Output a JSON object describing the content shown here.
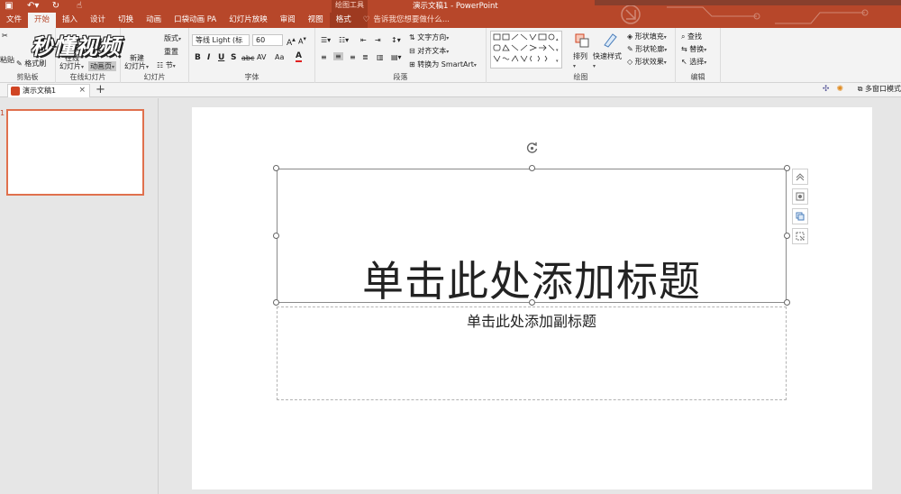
{
  "titlebar": {
    "window_title": "演示文稿1 - PowerPoint",
    "context_tools_label": "绘图工具",
    "tell_me_placeholder": "告诉我您想要做什么..."
  },
  "tabs": [
    {
      "label": "文件"
    },
    {
      "label": "开始"
    },
    {
      "label": "插入"
    },
    {
      "label": "设计"
    },
    {
      "label": "切换"
    },
    {
      "label": "动画"
    },
    {
      "label": "口袋动画 PA"
    },
    {
      "label": "幻灯片放映"
    },
    {
      "label": "审阅"
    },
    {
      "label": "视图"
    },
    {
      "label": "格式"
    }
  ],
  "ribbon": {
    "clipboard": {
      "paste": "粘贴",
      "format_painter": "格式刷",
      "label": "剪贴板"
    },
    "online_slides": {
      "online": "在线",
      "slide": "幻灯片",
      "anim": "动画页",
      "label": "在线幻灯片"
    },
    "slides": {
      "new": "新建",
      "slide": "幻灯片",
      "layout": "版式",
      "reset": "重置",
      "section": "节",
      "label": "幻灯片"
    },
    "font": {
      "name": "等线 Light (标",
      "size": "60",
      "label": "字体",
      "bold": "B",
      "italic": "I",
      "underline": "U",
      "shadow": "S",
      "strike": "abc",
      "spacing": "AV",
      "case": "Aa",
      "color": "A"
    },
    "paragraph": {
      "text_direction": "文字方向",
      "align_text": "对齐文本",
      "smartart": "转换为 SmartArt",
      "label": "段落"
    },
    "drawing": {
      "arrange": "排列",
      "quick_styles": "快速样式",
      "shape_fill": "形状填充",
      "shape_outline": "形状轮廓",
      "shape_effects": "形状效果",
      "label": "绘图"
    },
    "editing": {
      "find": "查找",
      "replace": "替换",
      "select": "选择",
      "label": "编辑"
    }
  },
  "logo_text": "秒懂视频",
  "doc_tab": {
    "name": "演示文稿1",
    "multi_window": "多窗口模式"
  },
  "slide": {
    "number": "1",
    "title_placeholder": "单击此处添加标题",
    "subtitle_placeholder": "单击此处添加副标题"
  }
}
